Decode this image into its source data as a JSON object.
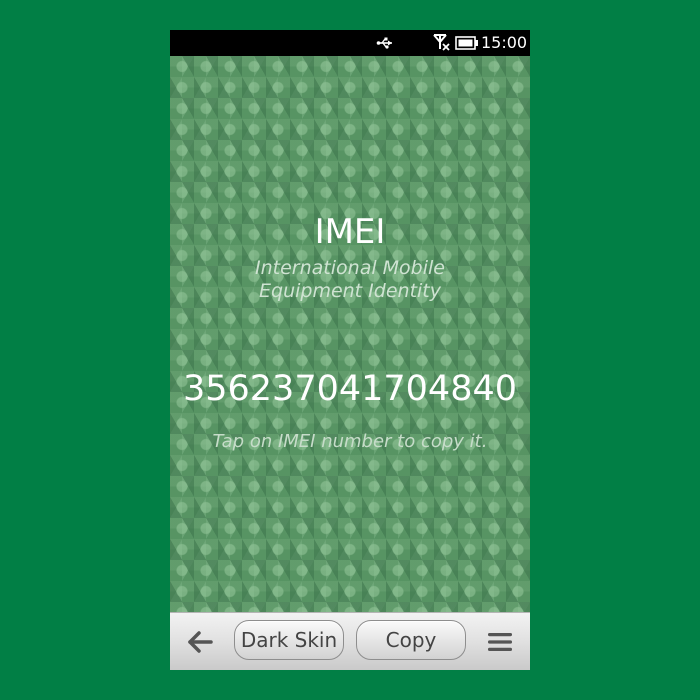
{
  "status_bar": {
    "time": "15:00",
    "icons": [
      "usb-icon",
      "signal-off-icon",
      "battery-icon"
    ]
  },
  "main": {
    "title": "IMEI",
    "subtitle_line1": "International Mobile",
    "subtitle_line2": "Equipment Identity",
    "imei_number": "356237041704840",
    "hint": "Tap on IMEI number to copy it."
  },
  "toolbar": {
    "back_icon": "back-arrow-icon",
    "dark_skin_label": "Dark Skin",
    "copy_label": "Copy",
    "menu_icon": "menu-icon"
  },
  "colors": {
    "outer_background": "#017f45",
    "content_green": "#5a9866",
    "text_white": "#ffffff"
  }
}
